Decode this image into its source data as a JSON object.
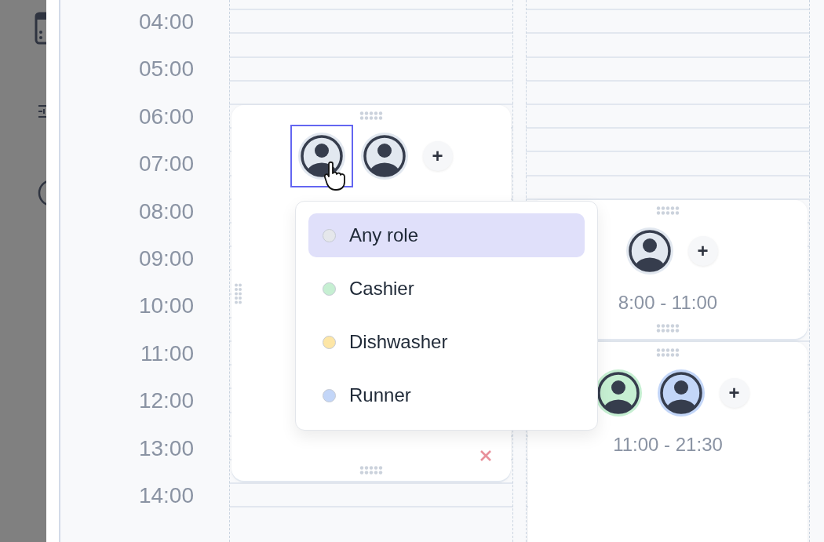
{
  "time_labels": [
    "04:00",
    "05:00",
    "06:00",
    "07:00",
    "08:00",
    "09:00",
    "10:00",
    "11:00",
    "12:00",
    "13:00",
    "14:00"
  ],
  "columns": [
    {
      "shifts": [
        {
          "avatars": [
            {
              "color": "#e2e8f0",
              "selected": true
            },
            {
              "color": "#e2e8f0",
              "selected": false
            }
          ],
          "add_label": "+",
          "deletable": true
        }
      ]
    },
    {
      "shifts": [
        {
          "avatars": [
            {
              "color": "#e2e8f0",
              "selected": false
            }
          ],
          "add_label": "+",
          "time": "8:00 - 11:00"
        },
        {
          "avatars": [
            {
              "color": "#c6efd2",
              "selected": false
            },
            {
              "color": "#c3d6f8",
              "selected": false
            }
          ],
          "add_label": "+",
          "time": "11:00 - 21:30"
        }
      ]
    }
  ],
  "role_menu": {
    "options": [
      {
        "label": "Any role",
        "color": "#e5e7eb",
        "selected": true
      },
      {
        "label": "Cashier",
        "color": "#c6efd2",
        "selected": false
      },
      {
        "label": "Dishwasher",
        "color": "#fde6a6",
        "selected": false
      },
      {
        "label": "Runner",
        "color": "#c3d6f8",
        "selected": false
      }
    ]
  }
}
